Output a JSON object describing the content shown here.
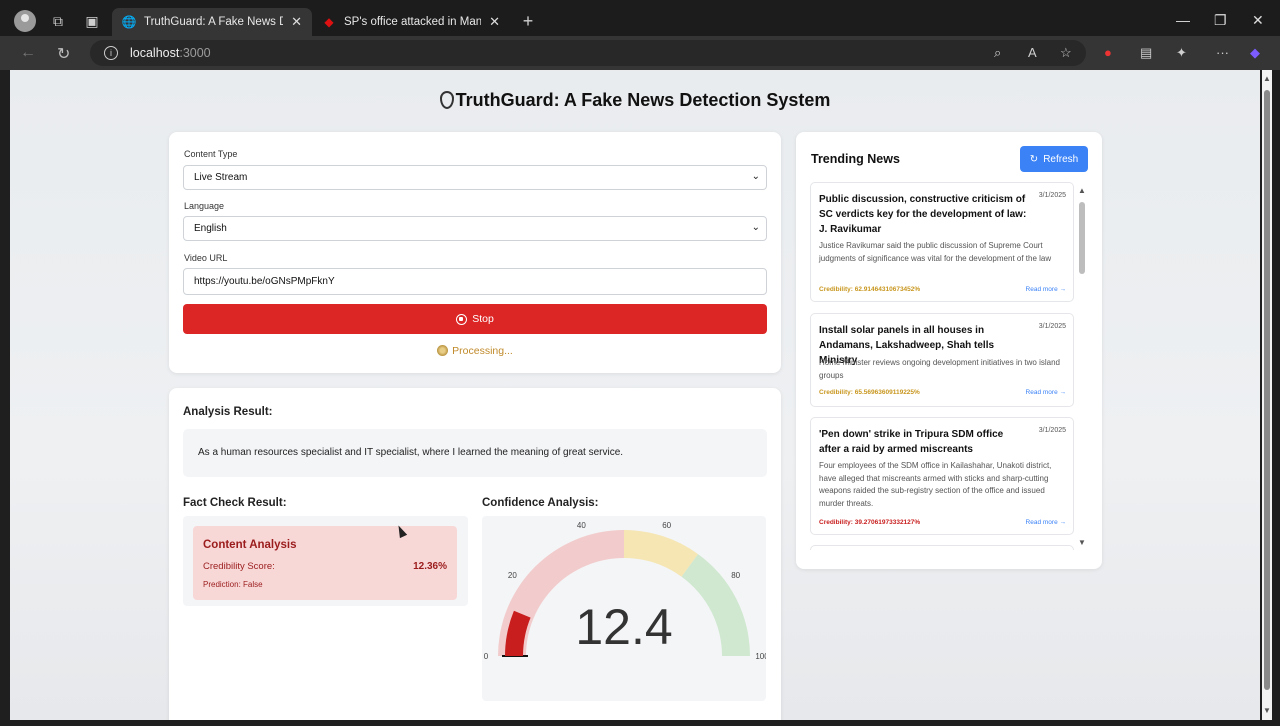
{
  "browser": {
    "tabs": [
      {
        "title": "TruthGuard: A Fake News Detecti",
        "active": true
      },
      {
        "title": "SP's office attacked in Manipur's",
        "active": false
      }
    ],
    "url_host": "localhost",
    "url_port": ":3000"
  },
  "page": {
    "title": "TruthGuard: A Fake News Detection System"
  },
  "form": {
    "content_type_label": "Content Type",
    "content_type_value": "Live Stream",
    "language_label": "Language",
    "language_value": "English",
    "video_url_label": "Video URL",
    "video_url_value": "https://youtu.be/oGNsPMpFknY",
    "stop_label": "Stop",
    "processing_label": "Processing..."
  },
  "analysis": {
    "heading": "Analysis Result:",
    "text": "As a human resources specialist and IT specialist, where I learned the meaning of great service."
  },
  "fact_check": {
    "heading": "Fact Check Result:",
    "box_title": "Content Analysis",
    "score_label": "Credibility Score:",
    "score_value": "12.36%",
    "prediction": "Prediction: False"
  },
  "confidence": {
    "heading": "Confidence Analysis:",
    "value": 12.4,
    "value_text": "12.4",
    "min": 0,
    "max": 100,
    "ticks": [
      "0",
      "20",
      "40",
      "60",
      "80",
      "100"
    ],
    "colors": {
      "low": "#f2cccc",
      "mid": "#f5e6b4",
      "high": "#cfe8cf",
      "needle": "#c81e1e"
    }
  },
  "trending": {
    "title": "Trending News",
    "refresh_label": "Refresh",
    "items": [
      {
        "title": "Public discussion, constructive criticism of SC verdicts key for the development of law: J. Ravikumar",
        "date": "3/1/2025",
        "desc": "Justice Ravikumar said the public discussion of Supreme Court judgments of significance was vital for the development of the law",
        "credibility": "Credibility: 62.91464310673452%",
        "cred_color": "#c8961e",
        "read_more": "Read more →"
      },
      {
        "title": "Install solar panels in all houses in Andamans, Lakshadweep, Shah tells Ministry",
        "date": "3/1/2025",
        "desc": "Home Minister reviews ongoing development initiatives in two island groups",
        "credibility": "Credibility: 65.56963609119225%",
        "cred_color": "#c8961e",
        "read_more": "Read more →"
      },
      {
        "title": "'Pen down' strike in Tripura SDM office after a raid by armed miscreants",
        "date": "3/1/2025",
        "desc": "Four employees of the SDM office in Kailashahar, Unakoti district, have alleged that miscreants armed with sticks and sharp-cutting weapons raided the sub-registry section of the office and issued murder threats.",
        "credibility": "Credibility: 39.27061973332127%",
        "cred_color": "#c81e1e",
        "read_more": "Read more →"
      }
    ]
  }
}
